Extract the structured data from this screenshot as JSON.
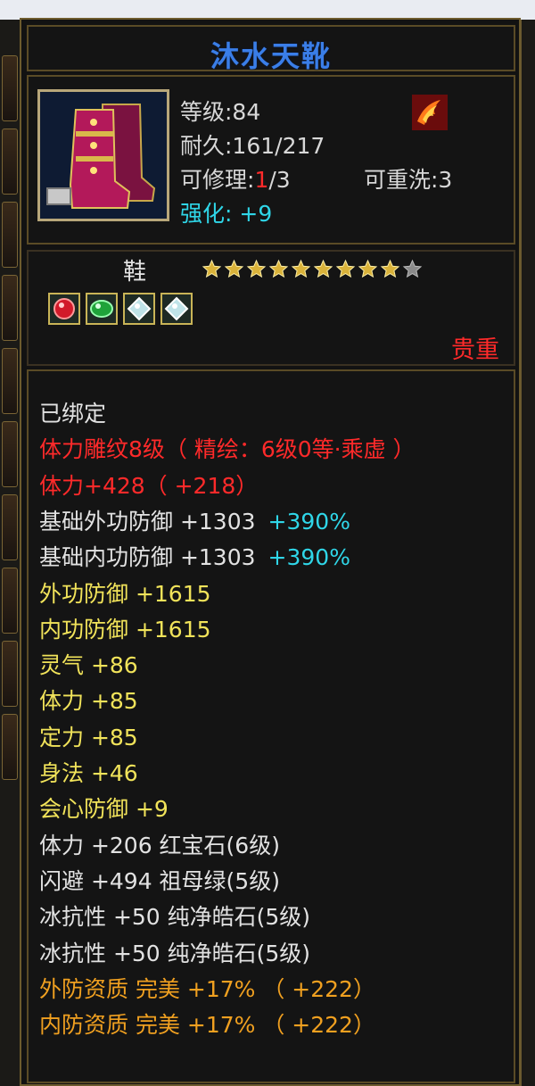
{
  "item": {
    "name": "沐水天靴",
    "level": "等级:84",
    "durability": "耐久:161/217",
    "repair_prefix": "可修理:",
    "repair_current": "1",
    "repair_max": "/3",
    "rewash": "可重洗:3",
    "enhance_label": "强化:",
    "enhance_value": "+9",
    "type": "鞋",
    "stars_filled": 9,
    "stars_total": 10,
    "precious": "贵重",
    "gems": [
      "red-gem",
      "green-gem",
      "white-gem",
      "white-gem"
    ]
  },
  "attributes": [
    {
      "text": "已绑定",
      "color": "white"
    },
    {
      "text": "体力雕纹8级（ 精绘：6级0等·乘虚 ）",
      "color": "red"
    },
    {
      "text": "体力+428（ +218）",
      "color": "red"
    },
    {
      "text": "基础外功防御 +1303",
      "extra": "+390%",
      "color": "white"
    },
    {
      "text": "基础内功防御 +1303",
      "extra": "+390%",
      "color": "white"
    },
    {
      "text": "外功防御 +1615",
      "color": "yellow"
    },
    {
      "text": "内功防御 +1615",
      "color": "yellow"
    },
    {
      "text": "灵气 +86",
      "color": "yellow"
    },
    {
      "text": "体力 +85",
      "color": "yellow"
    },
    {
      "text": "定力 +85",
      "color": "yellow"
    },
    {
      "text": "身法 +46",
      "color": "yellow"
    },
    {
      "text": "会心防御 +9",
      "color": "yellow"
    },
    {
      "text": "体力 +206 红宝石(6级)",
      "color": "white"
    },
    {
      "text": "闪避 +494 祖母绿(5级)",
      "color": "white"
    },
    {
      "text": "冰抗性 +50 纯净皓石(5级)",
      "color": "white"
    },
    {
      "text": "冰抗性 +50 纯净皓石(5级)",
      "color": "white"
    },
    {
      "text": "外防资质   完美 +17% （ +222）",
      "color": "orange"
    },
    {
      "text": "内防资质   完美 +17% （ +222）",
      "color": "orange"
    }
  ],
  "colors": {
    "title": "#3a7ee8",
    "red": "#ff2a2a",
    "cyan": "#2fd6e8",
    "yellow": "#f1e35a",
    "orange": "#f0a020",
    "border_gold": "#6d5b2e"
  }
}
